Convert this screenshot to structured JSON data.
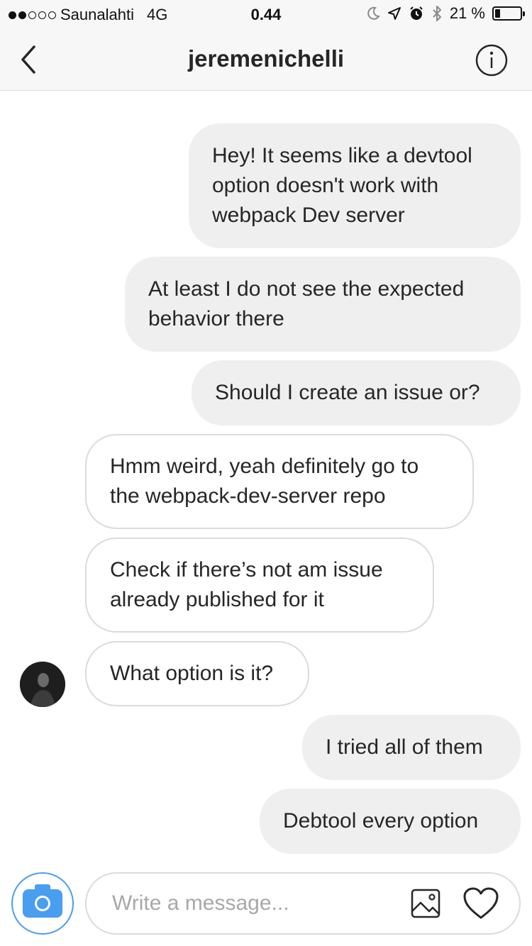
{
  "status_bar": {
    "carrier": "Saunalahti",
    "network": "4G",
    "time": "0.44",
    "battery_label": "21 %",
    "battery_level": 0.21,
    "icons": [
      "moon-icon",
      "location-arrow-icon",
      "alarm-icon",
      "bluetooth-icon",
      "battery-icon"
    ]
  },
  "header": {
    "title": "jeremenichelli",
    "back_icon": "chevron-left-icon",
    "info_icon": "info-icon"
  },
  "messages": [
    {
      "direction": "outgoing",
      "text": "Hey! It seems like a devtool\noption doesn't work with\nwebpack Dev server"
    },
    {
      "direction": "outgoing",
      "text": "At least I do not see the expected\nbehavior there"
    },
    {
      "direction": "outgoing",
      "text": "Should I create an issue or?"
    },
    {
      "direction": "incoming",
      "text": "Hmm weird, yeah definitely go to\nthe webpack-dev-server repo"
    },
    {
      "direction": "incoming",
      "text": "Check if there’s not am issue\nalready published for it"
    },
    {
      "direction": "incoming",
      "text": "What option is it?"
    },
    {
      "direction": "outgoing",
      "text": "I tried all of them"
    },
    {
      "direction": "outgoing",
      "text": "Debtool every option"
    }
  ],
  "composer": {
    "placeholder": "Write a message...",
    "camera_icon": "camera-icon",
    "gallery_icon": "image-icon",
    "like_icon": "heart-icon"
  },
  "colors": {
    "accent": "#4a9ef0",
    "outgoing_bubble": "#efefef",
    "incoming_border": "#dbdbdb",
    "header_bg": "#f7f7f7"
  }
}
